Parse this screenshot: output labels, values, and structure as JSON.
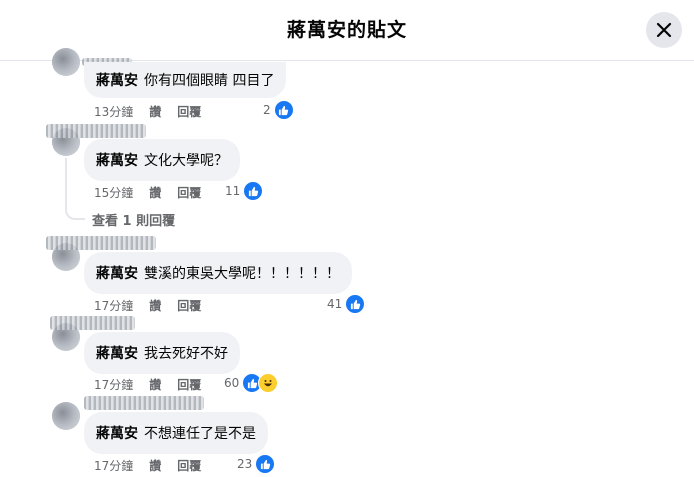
{
  "header": {
    "title": "蔣萬安的貼文"
  },
  "comments": [
    {
      "author": "蔣萬安",
      "text": "你有四個眼睛 四目了",
      "time": "13分鐘",
      "like": "讚",
      "reply": "回覆",
      "count": "2"
    },
    {
      "author": "蔣萬安",
      "text": "文化大學呢？",
      "time": "15分鐘",
      "like": "讚",
      "reply": "回覆",
      "count": "11",
      "view_replies": "查看 1 則回覆"
    },
    {
      "author": "蔣萬安",
      "text": "雙溪的東吳大學呢！！！！！！",
      "time": "17分鐘",
      "like": "讚",
      "reply": "回覆",
      "count": "41"
    },
    {
      "author": "蔣萬安",
      "text": "我去死好不好",
      "time": "17分鐘",
      "like": "讚",
      "reply": "回覆",
      "count": "60"
    },
    {
      "author": "蔣萬安",
      "text": "不想連任了是不是",
      "time": "17分鐘",
      "like": "讚",
      "reply": "回覆",
      "count": "23"
    }
  ],
  "icons": {
    "close": "close-icon",
    "like": "like-reaction-icon",
    "haha": "haha-reaction-icon"
  },
  "colors": {
    "like_blue": "#1877f2",
    "bubble": "#f0f2f5",
    "meta": "#65676b"
  }
}
